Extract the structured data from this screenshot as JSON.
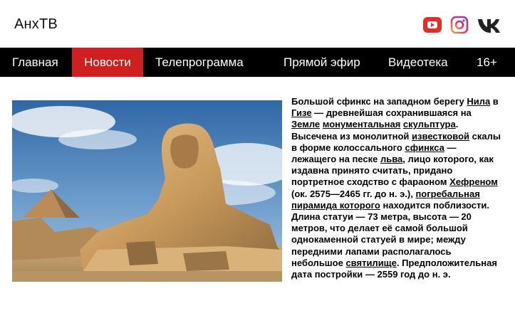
{
  "site": {
    "logo": "АнхТВ"
  },
  "socials": [
    {
      "icon": "youtube-icon",
      "color": "#e52d27"
    },
    {
      "icon": "instagram-icon",
      "color": "#c13584"
    },
    {
      "icon": "vk-icon",
      "color": "#2a2a2a"
    }
  ],
  "nav": {
    "items": [
      {
        "label": "Главная"
      },
      {
        "label": "Новости",
        "active": true
      },
      {
        "label": "Телепрограмма"
      },
      {
        "label": "Прямой эфир"
      },
      {
        "label": "Видеотека"
      },
      {
        "label": "16+"
      }
    ],
    "active_color": "#d01f1f"
  },
  "article": {
    "t1": "Большой сфинкс на западном берегу ",
    "l1": "Нила",
    "t2": " в ",
    "l2": "Гизе",
    "t3": " — древнейшая сохранившаяся на ",
    "l3": "Земле",
    "t4": " ",
    "l4": "монументальная",
    "t5": " ",
    "l5": "скульптура",
    "t6": ". Высечена из монолитной ",
    "l6": "известковой",
    "t7": " скалы в форме колоссального ",
    "l7": "сфинкса",
    "t8": " — лежащего на песке ",
    "l8": "льва",
    "t9": ", лицо которого, как издавна принято считать, придано портретное сходство с фараоном ",
    "l9": "Хефреном",
    "t10": " (ок. 2575—2465 гг. до н. э.), ",
    "l10": "погребальная пирамида которого",
    "t11": " находится поблизости. Длина статуи — 73 метра, высота — 20 метров, что делает её самой большой однокаменной статуей в мире; между передними лапами располагалось небольшое ",
    "l11": "святилище",
    "t12": ". Предположительная дата постройки — 2559 год до н. э."
  }
}
